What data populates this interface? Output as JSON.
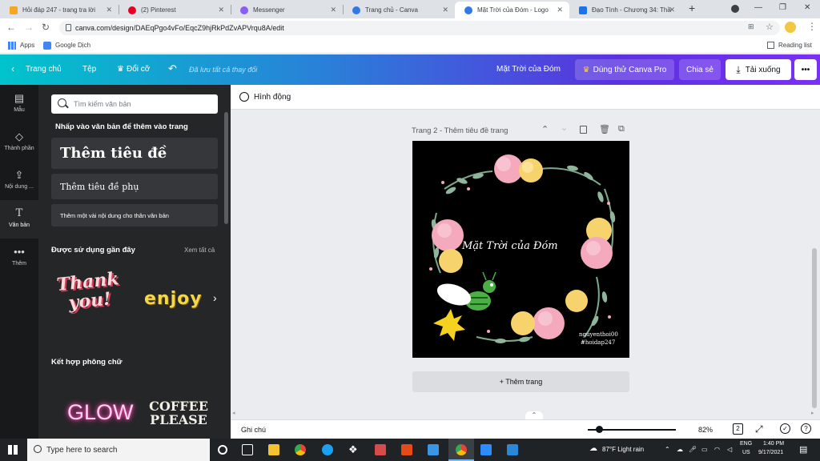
{
  "browser": {
    "tabs": [
      {
        "label": "Hỏi đáp 247 - trang tra lời",
        "favicon_color": "#f5a623"
      },
      {
        "label": "(2) Pinterest",
        "favicon_color": "#e60023"
      },
      {
        "label": "Messenger",
        "favicon_color": "#8b5cf6"
      },
      {
        "label": "Trang chủ - Canva",
        "favicon_color": "#2f7ae5"
      },
      {
        "label": "Mặt Trời của Đóm - Logo",
        "favicon_color": "#2f7ae5"
      },
      {
        "label": "Đạo Tình - Chương 34: Thầ",
        "favicon_color": "#1a73e8"
      }
    ],
    "new_tab_label": "+",
    "window_controls": {
      "minimize": "—",
      "restore": "❐",
      "close": "✕"
    },
    "url": "canva.com/design/DAEqPgo4vFo/EqcZ9hjRkPdZvAPVrqu8A/edit",
    "bookmarks": {
      "apps": "Apps",
      "google_dich": "Google Dịch",
      "reading_list": "Reading list"
    }
  },
  "canva_header": {
    "home": "Trang chủ",
    "file": "Tệp",
    "resize": "Đổi cỡ",
    "saved_status": "Đã lưu tất cả thay đổi",
    "design_title": "Mặt Trời của Đóm",
    "try_pro": "Dùng thử Canva Pro",
    "share": "Chia sẻ",
    "download": "Tải xuống",
    "more": "•••"
  },
  "rail": {
    "items": [
      {
        "label": "Mẫu",
        "icon": "▤"
      },
      {
        "label": "Thành phần",
        "icon": "◇"
      },
      {
        "label": "Nội dung ...",
        "icon": "⇪"
      },
      {
        "label": "Văn bản",
        "icon": "T"
      },
      {
        "label": "Thêm",
        "icon": "•••"
      }
    ]
  },
  "panel": {
    "search_placeholder": "Tìm kiếm văn bản",
    "instruction": "Nhấp vào văn bản để thêm vào trang",
    "add_heading": "Thêm tiêu đề",
    "add_subheading": "Thêm tiêu đề phụ",
    "add_body": "Thêm một vài nội dung cho thân văn bản",
    "recent_title": "Được sử dụng gần đây",
    "see_all": "Xem tất cả",
    "recent_items": [
      "Thank you!",
      "enjoy"
    ],
    "font_combos_title": "Kết hợp phông chữ",
    "font_combos": [
      "GLOW",
      "COFFEE PLEASE"
    ]
  },
  "editor": {
    "animate": "Hình động",
    "page_label": "Trang 2 - Thêm tiêu đề trang",
    "design_text": "Mặt Trời của Đóm",
    "credit_line1": "nguyenthoi00",
    "credit_line2": "#hoidap247",
    "add_page": "+ Thêm trang",
    "notes": "Ghi chú",
    "zoom": "82%",
    "page_count": "2"
  },
  "taskbar": {
    "search_placeholder": "Type here to search",
    "weather": "87°F  Light rain",
    "language_line1": "ENG",
    "language_line2": "US",
    "time": "1:40 PM",
    "date": "9/17/2021"
  }
}
